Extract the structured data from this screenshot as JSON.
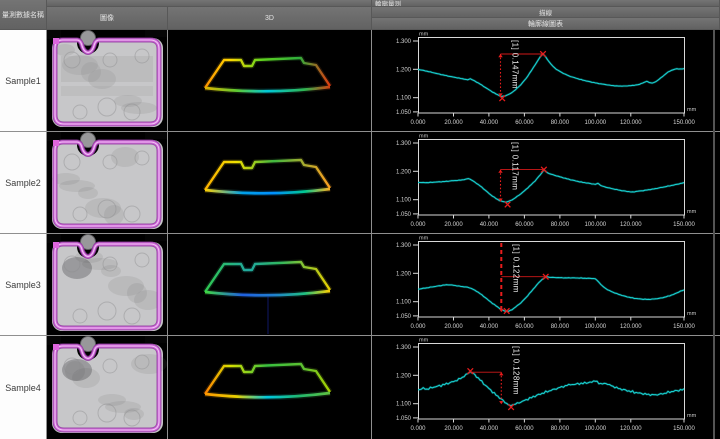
{
  "header": {
    "col_name": "量測數據名稱",
    "col_image": "圖像",
    "col_3d": "3D",
    "section_title": "輪廓量測",
    "sub_row1": "描線",
    "sub_row2": "輪廓線圖表"
  },
  "colors": {
    "background": "#000000",
    "header_bg": "#686868",
    "header_text": "#e3e3e3",
    "grid_line": "#8f8f8f",
    "name_cell_bg": "#fdfdfd",
    "curve": "#17cfcf",
    "annotation_red": "#e81c1c",
    "axis": "#d9d9d9",
    "outline_magenta": "#cf63d8"
  },
  "rows": [
    {
      "name": "Sample1",
      "annotation": "[1] 0.147mm"
    },
    {
      "name": "Sample2",
      "annotation": "[1] 0.117mm"
    },
    {
      "name": "Sample3",
      "annotation": "[1] 0.122mm"
    },
    {
      "name": "Sample4",
      "annotation": "[1] 0.128mm"
    }
  ],
  "chart_data": [
    {
      "type": "line",
      "sample": "Sample1",
      "title": "輪廓線圖表",
      "xlabel": "mm",
      "ylabel": "mm",
      "x_ticks": [
        "0.000",
        "20.000",
        "40.000",
        "60.000",
        "80.000",
        "100.000",
        "120.000",
        "150.000"
      ],
      "x_tick_values": [
        0,
        20,
        40,
        60,
        80,
        100,
        120,
        150
      ],
      "y_ticks": [
        "1.300",
        "1.200",
        "1.100",
        "1.050"
      ],
      "y_tick_values": [
        1.3,
        1.2,
        1.1,
        1.05
      ],
      "xlim": [
        0,
        150
      ],
      "ylim": [
        1.046,
        1.314
      ],
      "grid": false,
      "noise": 0.0008,
      "annotation": {
        "label": "[1] 0.147mm",
        "vline_x": 46.5,
        "vline_y1": 1.104,
        "vline_y2": 1.254,
        "hline_y": 1.254,
        "hline_x2": 70,
        "from_top": false,
        "marker_trough": [
          47.5,
          1.098
        ],
        "marker_peak": [
          70.5,
          1.254
        ]
      },
      "points": [
        [
          0,
          1.2
        ],
        [
          6,
          1.192
        ],
        [
          12,
          1.183
        ],
        [
          18,
          1.175
        ],
        [
          24,
          1.168
        ],
        [
          28,
          1.163
        ],
        [
          29.5,
          1.167
        ],
        [
          31,
          1.162
        ],
        [
          34,
          1.152
        ],
        [
          38,
          1.136
        ],
        [
          42,
          1.12
        ],
        [
          45,
          1.11
        ],
        [
          47,
          1.104
        ],
        [
          49,
          1.106
        ],
        [
          52,
          1.114
        ],
        [
          55,
          1.128
        ],
        [
          58,
          1.146
        ],
        [
          61,
          1.168
        ],
        [
          64,
          1.196
        ],
        [
          67,
          1.225
        ],
        [
          69,
          1.245
        ],
        [
          70.5,
          1.254
        ],
        [
          72,
          1.243
        ],
        [
          74,
          1.226
        ],
        [
          76,
          1.211
        ],
        [
          78,
          1.2
        ],
        [
          81,
          1.189
        ],
        [
          85,
          1.177
        ],
        [
          89,
          1.169
        ],
        [
          93,
          1.162
        ],
        [
          97,
          1.156
        ],
        [
          101,
          1.151
        ],
        [
          105,
          1.147
        ],
        [
          109,
          1.143
        ],
        [
          113,
          1.141
        ],
        [
          117,
          1.141
        ],
        [
          121,
          1.143
        ],
        [
          125,
          1.147
        ],
        [
          127.5,
          1.154
        ],
        [
          129,
          1.158
        ],
        [
          130.5,
          1.153
        ],
        [
          132,
          1.151
        ],
        [
          134,
          1.156
        ],
        [
          136,
          1.165
        ],
        [
          138,
          1.175
        ],
        [
          140,
          1.186
        ],
        [
          142,
          1.194
        ],
        [
          144,
          1.199
        ],
        [
          146,
          1.202
        ],
        [
          148,
          1.201
        ],
        [
          150,
          1.202
        ]
      ]
    },
    {
      "type": "line",
      "sample": "Sample2",
      "title": "輪廓線圖表",
      "xlabel": "mm",
      "ylabel": "mm",
      "x_ticks": [
        "0.000",
        "20.000",
        "40.000",
        "60.000",
        "80.000",
        "100.000",
        "120.000",
        "150.000"
      ],
      "x_tick_values": [
        0,
        20,
        40,
        60,
        80,
        100,
        120,
        150
      ],
      "y_ticks": [
        "1.300",
        "1.200",
        "1.100",
        "1.050"
      ],
      "y_tick_values": [
        1.3,
        1.2,
        1.1,
        1.05
      ],
      "xlim": [
        0,
        150
      ],
      "ylim": [
        1.046,
        1.314
      ],
      "grid": false,
      "noise": 0.001,
      "annotation": {
        "label": "[1] 0.117mm",
        "vline_x": 46.5,
        "vline_y1": 1.093,
        "vline_y2": 1.206,
        "hline_y": 1.206,
        "hline_x2": 71,
        "from_top": false,
        "marker_trough": [
          50.5,
          1.083
        ],
        "marker_peak": [
          71,
          1.206
        ]
      },
      "points": [
        [
          0,
          1.161
        ],
        [
          5,
          1.16
        ],
        [
          10,
          1.162
        ],
        [
          15,
          1.164
        ],
        [
          20,
          1.167
        ],
        [
          24,
          1.169
        ],
        [
          27,
          1.172
        ],
        [
          28.5,
          1.174
        ],
        [
          30,
          1.17
        ],
        [
          32,
          1.162
        ],
        [
          35,
          1.149
        ],
        [
          38,
          1.133
        ],
        [
          41,
          1.117
        ],
        [
          44,
          1.104
        ],
        [
          46,
          1.097
        ],
        [
          48,
          1.093
        ],
        [
          50,
          1.092
        ],
        [
          52,
          1.096
        ],
        [
          54,
          1.103
        ],
        [
          57,
          1.116
        ],
        [
          60,
          1.131
        ],
        [
          63,
          1.148
        ],
        [
          66,
          1.166
        ],
        [
          68,
          1.181
        ],
        [
          70,
          1.196
        ],
        [
          71,
          1.206
        ],
        [
          72,
          1.199
        ],
        [
          74,
          1.192
        ],
        [
          77,
          1.186
        ],
        [
          81,
          1.179
        ],
        [
          85,
          1.172
        ],
        [
          89,
          1.166
        ],
        [
          93,
          1.161
        ],
        [
          97,
          1.157
        ],
        [
          100,
          1.154
        ],
        [
          101.5,
          1.158
        ],
        [
          103,
          1.15
        ],
        [
          106,
          1.144
        ],
        [
          110,
          1.138
        ],
        [
          114,
          1.133
        ],
        [
          118,
          1.129
        ],
        [
          121,
          1.127
        ],
        [
          124,
          1.13
        ],
        [
          127,
          1.132
        ],
        [
          130,
          1.135
        ],
        [
          134,
          1.139
        ],
        [
          138,
          1.144
        ],
        [
          142,
          1.149
        ],
        [
          146,
          1.154
        ],
        [
          150,
          1.16
        ]
      ]
    },
    {
      "type": "line",
      "sample": "Sample3",
      "title": "輪廓線圖表",
      "xlabel": "mm",
      "ylabel": "mm",
      "x_ticks": [
        "0.000",
        "20.000",
        "40.000",
        "60.000",
        "80.000",
        "100.000",
        "120.000",
        "150.000"
      ],
      "x_tick_values": [
        0,
        20,
        40,
        60,
        80,
        100,
        120,
        150
      ],
      "y_ticks": [
        "1.300",
        "1.200",
        "1.100",
        "1.050"
      ],
      "y_tick_values": [
        1.3,
        1.2,
        1.1,
        1.05
      ],
      "xlim": [
        0,
        150
      ],
      "ylim": [
        1.046,
        1.314
      ],
      "grid": false,
      "noise": 0.001,
      "annotation": {
        "label": "[1] 0.122mm",
        "vline_x": 47,
        "vline_y1": 1.063,
        "vline_y2": 1.31,
        "hline_y": 1.188,
        "hline_x2": 72,
        "from_top": true,
        "marker_trough": [
          50,
          1.067
        ],
        "marker_peak": [
          72,
          1.188
        ]
      },
      "points": [
        [
          0,
          1.144
        ],
        [
          5,
          1.149
        ],
        [
          10,
          1.154
        ],
        [
          14,
          1.158
        ],
        [
          17,
          1.16
        ],
        [
          20,
          1.158
        ],
        [
          24,
          1.154
        ],
        [
          28,
          1.151
        ],
        [
          30,
          1.147
        ],
        [
          33,
          1.137
        ],
        [
          36,
          1.124
        ],
        [
          39,
          1.109
        ],
        [
          42,
          1.094
        ],
        [
          45,
          1.081
        ],
        [
          47,
          1.072
        ],
        [
          49,
          1.067
        ],
        [
          51,
          1.066
        ],
        [
          53,
          1.072
        ],
        [
          55,
          1.081
        ],
        [
          58,
          1.096
        ],
        [
          61,
          1.115
        ],
        [
          64,
          1.137
        ],
        [
          67,
          1.159
        ],
        [
          69,
          1.173
        ],
        [
          71,
          1.183
        ],
        [
          72.5,
          1.189
        ],
        [
          74,
          1.186
        ],
        [
          78,
          1.185
        ],
        [
          83,
          1.184
        ],
        [
          88,
          1.184
        ],
        [
          93,
          1.183
        ],
        [
          98,
          1.182
        ],
        [
          100,
          1.181
        ],
        [
          101.5,
          1.172
        ],
        [
          103,
          1.161
        ],
        [
          105,
          1.15
        ],
        [
          107,
          1.142
        ],
        [
          110,
          1.133
        ],
        [
          114,
          1.124
        ],
        [
          118,
          1.117
        ],
        [
          122,
          1.112
        ],
        [
          126,
          1.109
        ],
        [
          130,
          1.108
        ],
        [
          134,
          1.11
        ],
        [
          138,
          1.114
        ],
        [
          142,
          1.121
        ],
        [
          145,
          1.128
        ],
        [
          148,
          1.137
        ],
        [
          150,
          1.141
        ]
      ]
    },
    {
      "type": "line",
      "sample": "Sample4",
      "title": "輪廓線圖表",
      "xlabel": "mm",
      "ylabel": "mm",
      "x_ticks": [
        "0.000",
        "20.000",
        "40.000",
        "60.000",
        "80.000",
        "100.000",
        "120.000",
        "150.000"
      ],
      "x_tick_values": [
        0,
        20,
        40,
        60,
        80,
        100,
        120,
        150
      ],
      "y_ticks": [
        "1.300",
        "1.200",
        "1.100",
        "1.050"
      ],
      "y_tick_values": [
        1.3,
        1.2,
        1.1,
        1.05
      ],
      "xlim": [
        0,
        150
      ],
      "ylim": [
        1.046,
        1.314
      ],
      "grid": false,
      "noise": 0.0042,
      "annotation": {
        "label": "[1] 0.128mm",
        "vline_x": 47,
        "vline_y1": 1.098,
        "vline_y2": 1.211,
        "hline_y": 1.211,
        "hline_x2": 30,
        "from_top": false,
        "marker_trough": [
          52.5,
          1.088
        ],
        "marker_peak": [
          29.5,
          1.215
        ]
      },
      "points": [
        [
          0,
          1.149
        ],
        [
          3,
          1.154
        ],
        [
          5,
          1.151
        ],
        [
          8,
          1.157
        ],
        [
          10,
          1.16
        ],
        [
          12,
          1.163
        ],
        [
          14,
          1.166
        ],
        [
          16,
          1.17
        ],
        [
          18,
          1.174
        ],
        [
          20,
          1.178
        ],
        [
          22,
          1.183
        ],
        [
          24,
          1.189
        ],
        [
          26,
          1.197
        ],
        [
          28,
          1.206
        ],
        [
          29.5,
          1.213
        ],
        [
          31,
          1.207
        ],
        [
          33,
          1.196
        ],
        [
          35,
          1.184
        ],
        [
          37,
          1.171
        ],
        [
          39,
          1.159
        ],
        [
          41,
          1.148
        ],
        [
          43,
          1.136
        ],
        [
          45,
          1.126
        ],
        [
          47,
          1.116
        ],
        [
          49,
          1.105
        ],
        [
          51,
          1.097
        ],
        [
          52.5,
          1.093
        ],
        [
          54,
          1.097
        ],
        [
          56,
          1.101
        ],
        [
          58,
          1.106
        ],
        [
          60,
          1.111
        ],
        [
          63,
          1.119
        ],
        [
          66,
          1.127
        ],
        [
          69,
          1.134
        ],
        [
          72,
          1.141
        ],
        [
          75,
          1.147
        ],
        [
          78,
          1.153
        ],
        [
          81,
          1.159
        ],
        [
          84,
          1.164
        ],
        [
          86,
          1.169
        ],
        [
          88,
          1.166
        ],
        [
          90,
          1.172
        ],
        [
          92,
          1.169
        ],
        [
          94,
          1.175
        ],
        [
          96,
          1.172
        ],
        [
          98,
          1.178
        ],
        [
          100,
          1.18
        ],
        [
          102,
          1.173
        ],
        [
          104,
          1.169
        ],
        [
          106,
          1.172
        ],
        [
          108,
          1.166
        ],
        [
          110,
          1.161
        ],
        [
          112,
          1.156
        ],
        [
          114,
          1.152
        ],
        [
          116,
          1.149
        ],
        [
          118,
          1.146
        ],
        [
          120,
          1.143
        ],
        [
          123,
          1.139
        ],
        [
          126,
          1.136
        ],
        [
          129,
          1.133
        ],
        [
          132,
          1.131
        ],
        [
          135,
          1.132
        ],
        [
          138,
          1.135
        ],
        [
          141,
          1.14
        ],
        [
          144,
          1.144
        ],
        [
          147,
          1.147
        ],
        [
          150,
          1.15
        ]
      ]
    }
  ]
}
